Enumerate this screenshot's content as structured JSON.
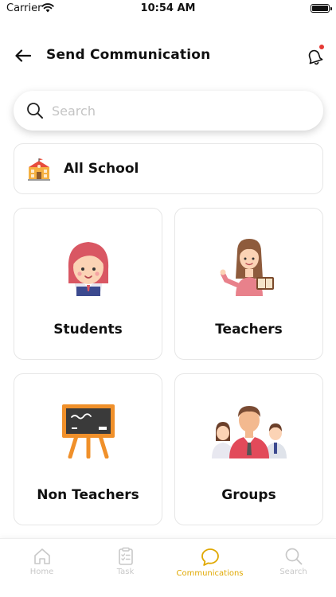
{
  "status_bar": {
    "carrier": "Carrier",
    "time": "10:54 AM"
  },
  "header": {
    "title": "Send Communication",
    "has_notification": true
  },
  "search": {
    "placeholder": "Search",
    "value": ""
  },
  "all_school": {
    "label": "All School",
    "icon": "school-building-icon"
  },
  "categories": [
    {
      "label": "Students",
      "icon": "student-girl-icon"
    },
    {
      "label": "Teachers",
      "icon": "teacher-with-book-icon"
    },
    {
      "label": "Non Teachers",
      "icon": "chalkboard-icon"
    },
    {
      "label": "Groups",
      "icon": "group-people-icon"
    }
  ],
  "bottom_nav": {
    "items": [
      {
        "label": "Home",
        "icon": "home-icon",
        "active": false
      },
      {
        "label": "Task",
        "icon": "clipboard-icon",
        "active": false
      },
      {
        "label": "Communications",
        "icon": "chat-bubble-icon",
        "active": true
      },
      {
        "label": "Search",
        "icon": "search-icon",
        "active": false
      }
    ]
  },
  "colors": {
    "accent": "#e0a800",
    "notification_dot": "#e53935",
    "inactive_nav": "#c8c8c8"
  }
}
